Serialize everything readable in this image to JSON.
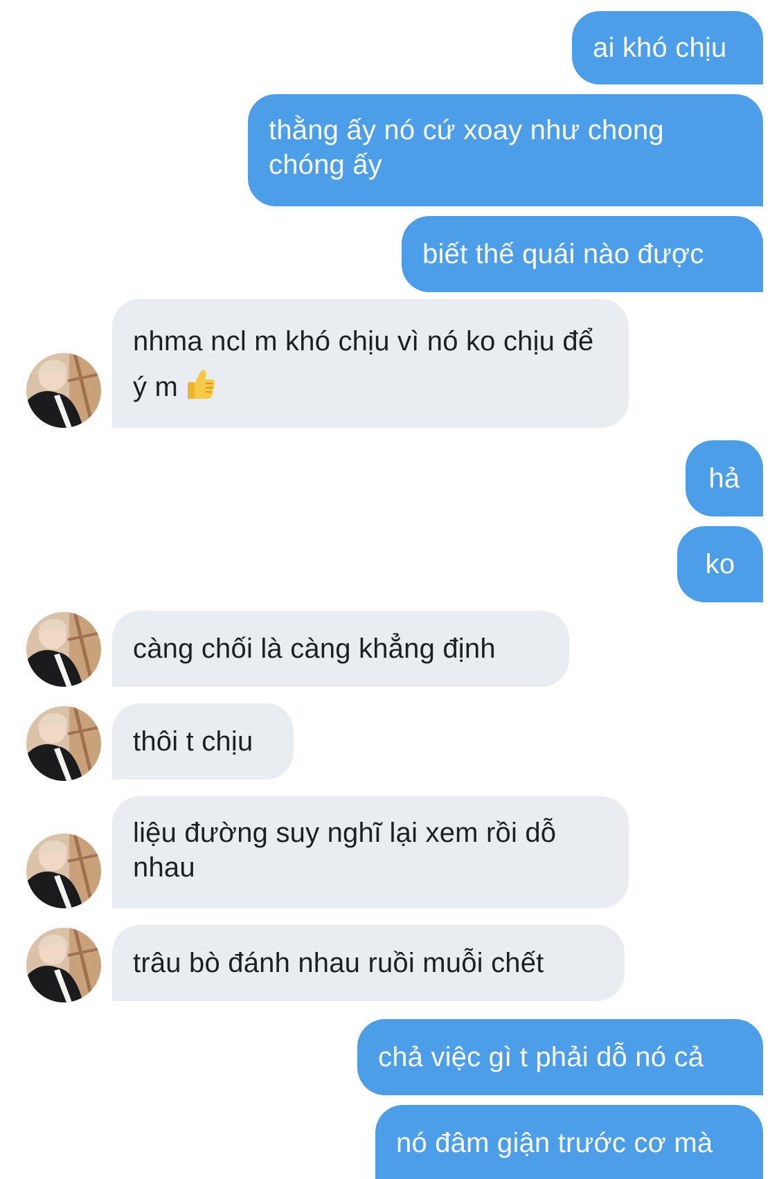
{
  "thread": {
    "messages": [
      {
        "side": "sent",
        "text": "ai khó chịu"
      },
      {
        "side": "sent",
        "text": "thằng ấy nó cứ xoay như chong chóng ấy"
      },
      {
        "side": "sent",
        "text": "biết thế quái nào được"
      },
      {
        "side": "received",
        "text": "nhma ncl m khó chịu vì nó ko chịu để ý m",
        "emoji": "thumbs-up-icon"
      },
      {
        "side": "sent",
        "text": "hả"
      },
      {
        "side": "sent",
        "text": "ko"
      },
      {
        "side": "received",
        "text": "càng chối là càng khẳng định"
      },
      {
        "side": "received",
        "text": "thôi t chịu"
      },
      {
        "side": "received",
        "text": "liệu đường suy nghĩ lại xem rồi dỗ nhau"
      },
      {
        "side": "received",
        "text": "trâu bò đánh nhau ruồi muỗi chết"
      },
      {
        "side": "sent",
        "text": "chả việc gì t phải dỗ nó cả"
      },
      {
        "side": "sent",
        "text": "nó đâm giận trước cơ mà"
      }
    ]
  },
  "colors": {
    "sent_bubble": "#4d9ee9",
    "sent_text": "#ffffff",
    "received_bubble": "#e9ecf0",
    "received_text": "#1c1f24"
  }
}
